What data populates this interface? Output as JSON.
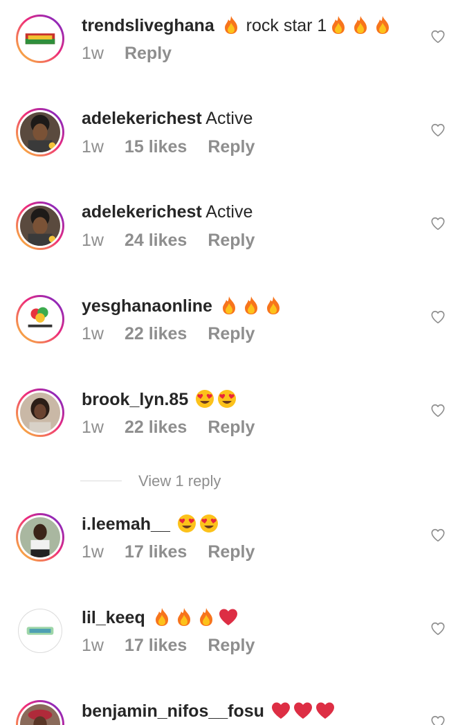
{
  "comments": [
    {
      "username": "trendsliveghana",
      "text": "rock star 1",
      "time": "1w",
      "likes": "",
      "reply": "Reply",
      "emojis": [
        "fire",
        "fire",
        "fire"
      ],
      "lead_emoji": "fire"
    },
    {
      "username": "adelekerichest",
      "text": "Active",
      "time": "1w",
      "likes": "15 likes",
      "reply": "Reply",
      "emojis": [],
      "lead_emoji": ""
    },
    {
      "username": "adelekerichest",
      "text": "Active",
      "time": "1w",
      "likes": "24 likes",
      "reply": "Reply",
      "emojis": [],
      "lead_emoji": ""
    },
    {
      "username": "yesghanaonline",
      "text": "",
      "time": "1w",
      "likes": "22 likes",
      "reply": "Reply",
      "emojis": [
        "fire",
        "fire",
        "fire"
      ],
      "lead_emoji": ""
    },
    {
      "username": "brook_lyn.85",
      "text": "",
      "time": "1w",
      "likes": "22 likes",
      "reply": "Reply",
      "emojis": [
        "heart-eyes",
        "heart-eyes"
      ],
      "lead_emoji": ""
    },
    {
      "username": "i.leemah__",
      "text": "",
      "time": "1w",
      "likes": "17 likes",
      "reply": "Reply",
      "emojis": [
        "heart-eyes",
        "heart-eyes"
      ],
      "lead_emoji": ""
    },
    {
      "username": "lil_keeq",
      "text": "",
      "time": "1w",
      "likes": "17 likes",
      "reply": "Reply",
      "emojis": [
        "fire",
        "fire",
        "fire",
        "red-heart"
      ],
      "lead_emoji": ""
    },
    {
      "username": "benjamin_nifos__fosu",
      "text": "",
      "time": "",
      "likes": "",
      "reply": "",
      "emojis": [
        "red-heart",
        "red-heart",
        "red-heart"
      ],
      "lead_emoji": ""
    }
  ],
  "view_replies": {
    "label": "View 1 reply"
  },
  "icons": {
    "like": "heart-outline-icon"
  },
  "colors": {
    "text": "#262626",
    "secondary": "#8e8e8e",
    "divider": "#dbdbdb",
    "heart_red": "#ed4956"
  }
}
